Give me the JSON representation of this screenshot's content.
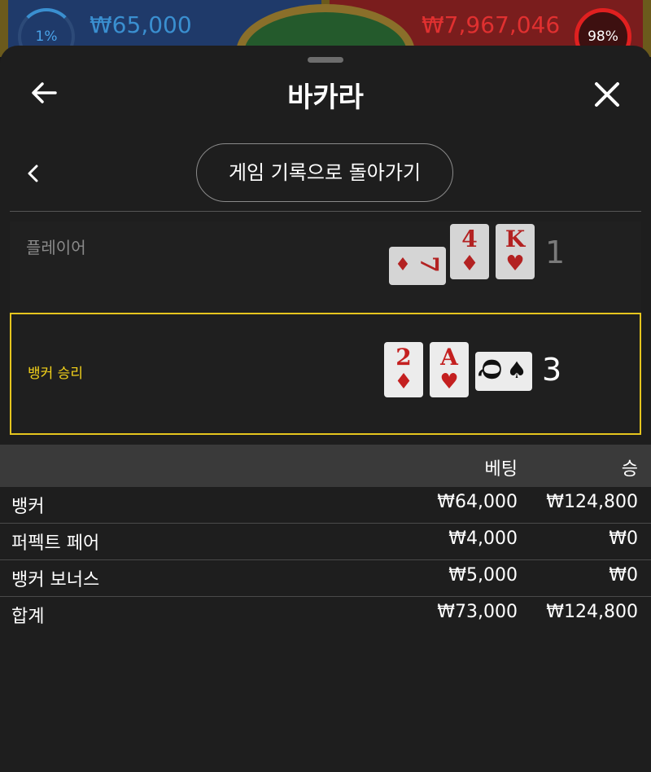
{
  "background": {
    "left_pct": "1%",
    "left_amount": "₩65,000",
    "right_amount": "₩7,967,046",
    "right_pct": "98%"
  },
  "header": {
    "title": "바카라",
    "back_icon": "arrow-left-icon",
    "close_icon": "close-icon"
  },
  "nav": {
    "history_button": "게임 기록으로 돌아가기",
    "chevron_icon": "chevron-left-icon"
  },
  "result": {
    "player": {
      "label": "플레이어",
      "score": "1",
      "cards": [
        {
          "rank": "7",
          "suit": "♦",
          "rotated": true
        },
        {
          "rank": "4",
          "suit": "♦",
          "rotated": false
        },
        {
          "rank": "K",
          "suit": "♥",
          "rotated": false
        }
      ]
    },
    "banker": {
      "label": "뱅커 승리",
      "score": "3",
      "cards": [
        {
          "rank": "2",
          "suit": "♦",
          "rotated": false
        },
        {
          "rank": "A",
          "suit": "♥",
          "rotated": false
        },
        {
          "rank": "Q",
          "suit": "♠",
          "rotated": true
        }
      ]
    }
  },
  "bets": {
    "headers": {
      "bet": "베팅",
      "win": "승"
    },
    "rows": [
      {
        "name": "뱅커",
        "bet": "₩64,000",
        "win": "₩124,800"
      },
      {
        "name": "퍼펙트 페어",
        "bet": "₩4,000",
        "win": "₩0"
      },
      {
        "name": "뱅커 보너스",
        "bet": "₩5,000",
        "win": "₩0"
      },
      {
        "name": "합계",
        "bet": "₩73,000",
        "win": "₩124,800"
      }
    ]
  },
  "colors": {
    "accent_yellow": "#e6c51e",
    "card_red": "#c42020",
    "sheet_bg": "#1e1e1e"
  }
}
